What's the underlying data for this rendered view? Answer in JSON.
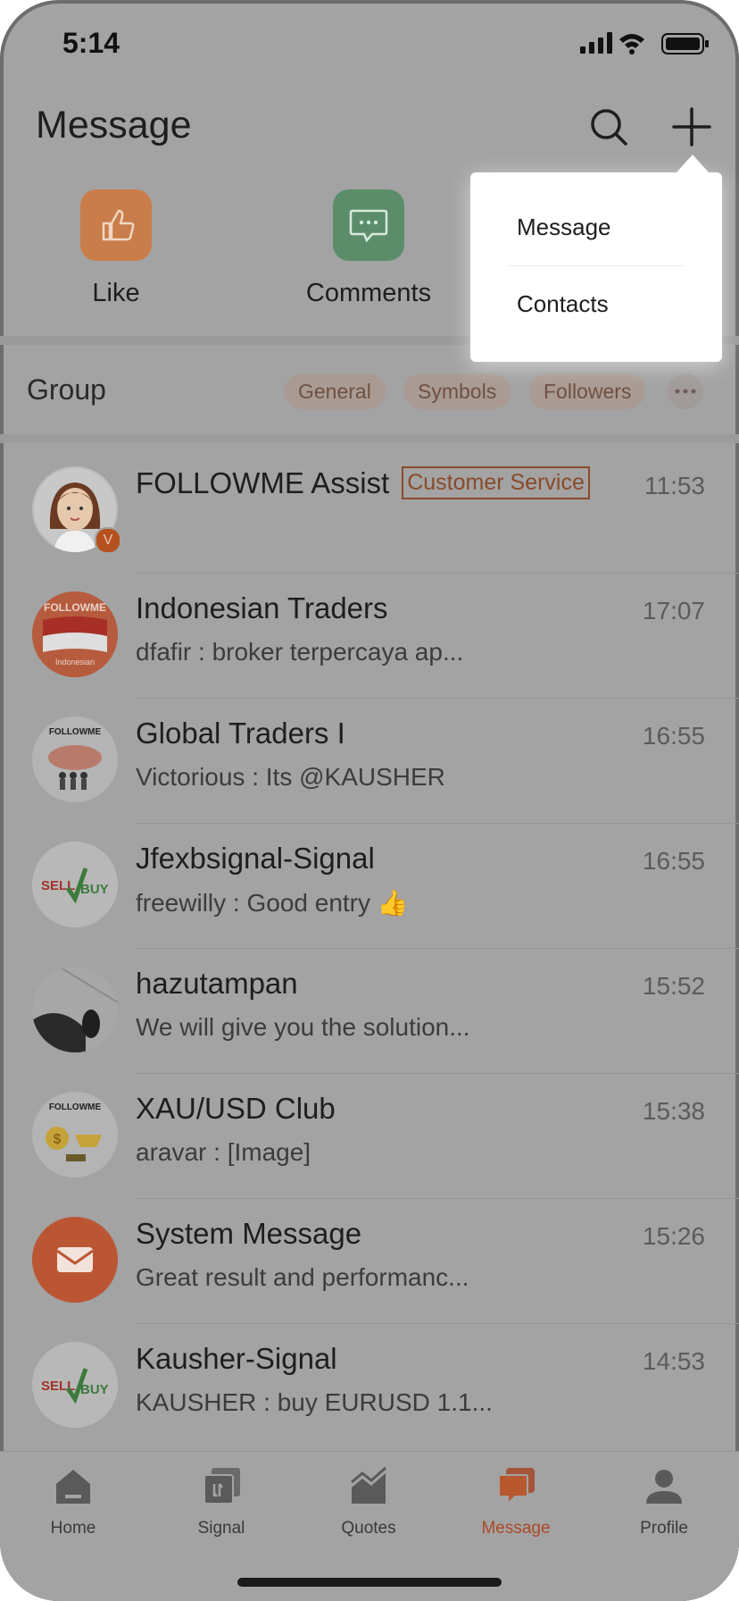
{
  "status_bar": {
    "time": "5:14"
  },
  "header": {
    "title": "Message"
  },
  "quick_actions": [
    {
      "label": "Like",
      "color": "#c97d4a"
    },
    {
      "label": "Comments",
      "color": "#5b8d6a"
    }
  ],
  "add_menu": {
    "items": [
      "Message",
      "Contacts"
    ]
  },
  "group": {
    "title": "Group",
    "chips": [
      "General",
      "Symbols",
      "Followers"
    ]
  },
  "conversations": [
    {
      "name": "FOLLOWME Assist",
      "badge": "Customer Service",
      "time": "11:53",
      "message": ""
    },
    {
      "name": "Indonesian Traders",
      "time": "17:07",
      "message": "dfafir : broker terpercaya ap...",
      "avatar_text": "FOLLOWME",
      "avatar_sub": "Indonesian"
    },
    {
      "name": "Global Traders I",
      "time": "16:55",
      "message": "Victorious : Its @KAUSHER",
      "avatar_text": "FOLLOWME"
    },
    {
      "name": "Jfexbsignal-Signal",
      "time": "16:55",
      "message": "freewilly : Good entry 👍",
      "avatar_sell": "SELL",
      "avatar_buy": "BUY"
    },
    {
      "name": "hazutampan",
      "time": "15:52",
      "message": "We will give you the solution..."
    },
    {
      "name": "XAU/USD Club",
      "time": "15:38",
      "message": "aravar : [Image]",
      "avatar_text": "FOLLOWME"
    },
    {
      "name": "System Message",
      "time": "15:26",
      "message": "Great result and performanc..."
    },
    {
      "name": "Kausher-Signal",
      "time": "14:53",
      "message": "KAUSHER : buy EURUSD 1.1...",
      "avatar_sell": "SELL",
      "avatar_buy": "BUY"
    }
  ],
  "tabs": [
    {
      "label": "Home",
      "icon": "home-icon"
    },
    {
      "label": "Signal",
      "icon": "signal-icon"
    },
    {
      "label": "Quotes",
      "icon": "quotes-icon"
    },
    {
      "label": "Message",
      "icon": "message-icon",
      "active": true
    },
    {
      "label": "Profile",
      "icon": "profile-icon"
    }
  ],
  "colors": {
    "accent": "#c0522b",
    "dim_overlay": "#a3a3a3"
  }
}
